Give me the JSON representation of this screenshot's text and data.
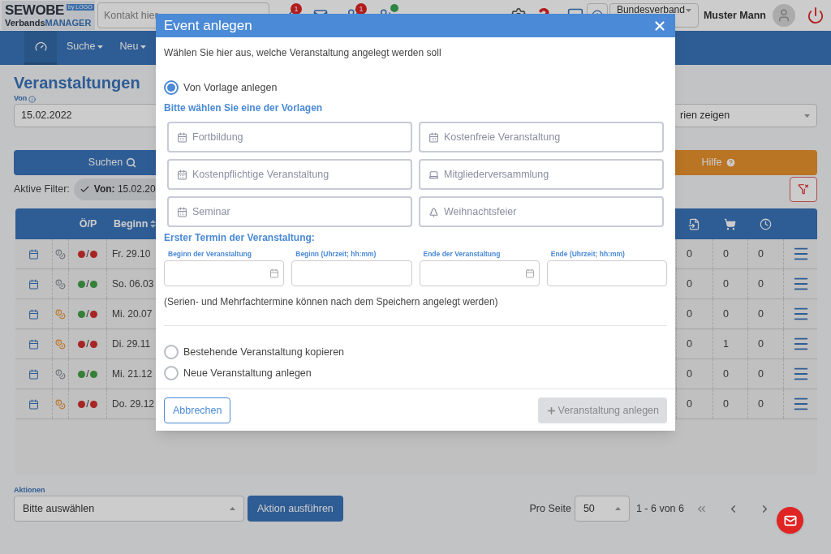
{
  "topbar": {
    "logo": {
      "name": "SEWOBE",
      "product_prefix": "Verbands",
      "product": "MANAGER",
      "stamp": "by LOGO"
    },
    "search": {
      "placeholder": "Kontakt hier"
    },
    "notifications": [
      {
        "kind": "tasks",
        "badge": "1"
      },
      {
        "kind": "mail"
      },
      {
        "kind": "users",
        "badge": "1"
      },
      {
        "kind": "add-user"
      }
    ],
    "org_select": "Bundesverband",
    "user": "Muster Mann"
  },
  "nav": [
    {
      "kind": "dashboard",
      "selected": true
    },
    {
      "kind": "menu",
      "label": "Suche",
      "selected": false
    },
    {
      "kind": "menu",
      "label": "Neu",
      "selected": false
    }
  ],
  "page": {
    "title": "Veranstaltungen",
    "from_label": "Von",
    "from_value": "15.02.2022",
    "category_select": "rien zeigen",
    "search_button": "Suchen",
    "help_button": "Hilfe",
    "active_filter_label": "Aktive Filter:",
    "filters": [
      {
        "key": "Von:",
        "value": "15.02.20"
      }
    ]
  },
  "table": {
    "columns": [
      {
        "label": "Ö/P"
      },
      {
        "label": "Beginn"
      }
    ],
    "rows": [
      {
        "paid": false,
        "o_active": false,
        "p_active": false,
        "separator": "/",
        "date": "Fr. 29.10",
        "counts": [
          "0",
          "0",
          "0"
        ]
      },
      {
        "paid": false,
        "o_active": true,
        "p_active": true,
        "separator": "/",
        "date": "So. 06.03",
        "counts": [
          "0",
          "0",
          "0"
        ]
      },
      {
        "paid": true,
        "o_active": true,
        "p_active": false,
        "separator": "/",
        "date": "Mi. 20.07",
        "counts": [
          "0",
          "0",
          "0"
        ]
      },
      {
        "paid": true,
        "o_active": false,
        "p_active": false,
        "separator": "/",
        "date": "Di. 29.11",
        "counts": [
          "0",
          "1",
          "0"
        ]
      },
      {
        "paid": false,
        "o_active": true,
        "p_active": true,
        "separator": "/",
        "date": "Mi. 21.12",
        "counts": [
          "0",
          "0",
          "0"
        ]
      },
      {
        "paid": true,
        "o_active": false,
        "p_active": false,
        "separator": "/",
        "date": "Do. 29.12",
        "counts": [
          "0",
          "0",
          "0"
        ]
      }
    ]
  },
  "footer": {
    "actions_label": "Aktionen",
    "actions_select": "Bitte auswählen",
    "run_button": "Aktion ausführen",
    "per_page_label": "Pro Seite",
    "per_page": "50",
    "range": "1 - 6 von 6"
  },
  "modal": {
    "title": "Event anlegen",
    "intro": "Wählen Sie hier aus, welche Veranstaltung angelegt werden soll",
    "template_option": {
      "label": "Von Vorlage anlegen",
      "selected": true
    },
    "templates_heading": "Bitte wählen Sie eine der Vorlagen",
    "templates": [
      {
        "label": "Fortbildung",
        "kind": "course"
      },
      {
        "label": "Kostenfreie Veranstaltung",
        "kind": "course"
      },
      {
        "label": "Kostenpflichtige Veranstaltung",
        "kind": "course"
      },
      {
        "label": "Mitgliederversammlung",
        "kind": "assembly"
      },
      {
        "label": "Seminar",
        "kind": "course"
      },
      {
        "label": "Weihnachtsfeier",
        "kind": "party"
      }
    ],
    "first_date_heading": "Erster Termin der Veranstaltung:",
    "date_fields": [
      {
        "label": "Beginn der Veranstaltung",
        "kind": "date"
      },
      {
        "label": "Beginn (Uhrzeit; hh:mm)",
        "kind": "time"
      },
      {
        "label": "Ende der Veranstaltung",
        "kind": "date"
      },
      {
        "label": "Ende (Uhrzeit; hh:mm)",
        "kind": "time"
      }
    ],
    "note": "(Serien- und Mehrfachtermine können nach dem Speichern angelegt werden)",
    "other_options": [
      {
        "label": "Bestehende Veranstaltung kopieren",
        "selected": false
      },
      {
        "label": "Neue Veranstaltung anlegen",
        "selected": false
      }
    ],
    "cancel_button": "Abbrechen",
    "submit_button": {
      "label": "Veranstaltung anlegen",
      "disabled": true
    }
  }
}
